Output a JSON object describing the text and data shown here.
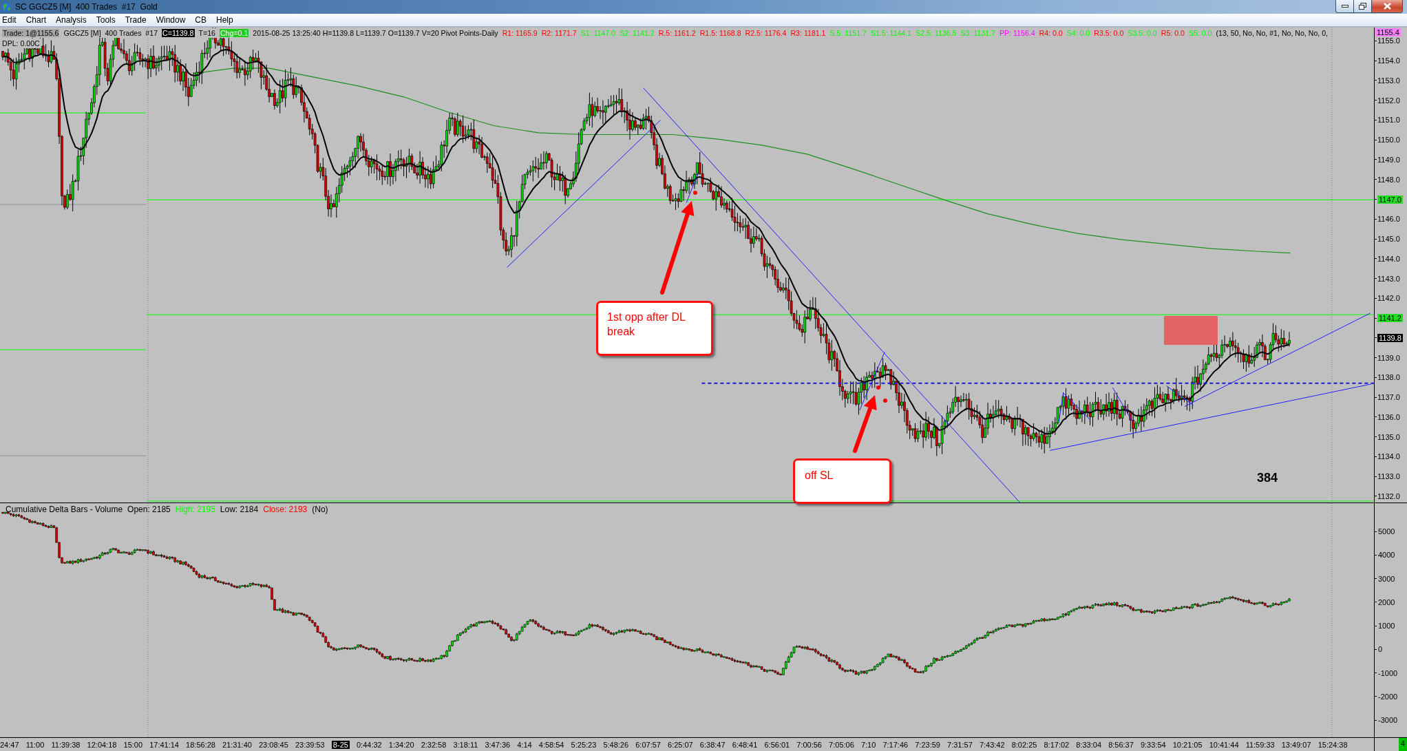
{
  "window": {
    "title": "SC GGCZ5 [M]  400 Trades  #17  Gold"
  },
  "menu": [
    "Edit",
    "Chart",
    "Analysis",
    "Tools",
    "Trade",
    "Window",
    "CB",
    "Help"
  ],
  "main_chart": {
    "info_line": [
      {
        "text": "Trade: 1@1155.6",
        "kind": "box",
        "color": "#a8a8a8"
      },
      {
        "text": "GGCZ5 [M]  400 Trades  #17",
        "kind": "text",
        "color": "#000000"
      },
      {
        "text": "C=1139.8",
        "kind": "box",
        "color": "#000000"
      },
      {
        "text": "T=16",
        "kind": "text",
        "color": "#000000"
      },
      {
        "text": "Chg=0.1",
        "kind": "box",
        "color": "#22cc22"
      },
      {
        "text": "2015-08-25 13:25:40 H=1139.8 L=1139.7 O=1139.7 V=20 Pivot Points-Daily",
        "kind": "text",
        "color": "#000000"
      },
      {
        "text": "R1: 1165.9",
        "kind": "text",
        "color": "#ff0000"
      },
      {
        "text": "R2: 1171.7",
        "kind": "text",
        "color": "#ff0000"
      },
      {
        "text": "S1: 1147.0",
        "kind": "text",
        "color": "#00ff00"
      },
      {
        "text": "S2: 1141.2",
        "kind": "text",
        "color": "#00ff00"
      },
      {
        "text": "R.5: 1161.2",
        "kind": "text",
        "color": "#ff0000"
      },
      {
        "text": "R1.5: 1168.8",
        "kind": "text",
        "color": "#ff0000"
      },
      {
        "text": "R2.5: 1176.4",
        "kind": "text",
        "color": "#ff0000"
      },
      {
        "text": "R3: 1181.1",
        "kind": "text",
        "color": "#ff0000"
      },
      {
        "text": "S.5: 1151.7",
        "kind": "text",
        "color": "#00ff00"
      },
      {
        "text": "S1.5: 1144.1",
        "kind": "text",
        "color": "#00ff00"
      },
      {
        "text": "S2.5: 1136.5",
        "kind": "text",
        "color": "#00ff00"
      },
      {
        "text": "S3: 1131.7",
        "kind": "text",
        "color": "#00ff00"
      },
      {
        "text": "PP: 1156.4",
        "kind": "text",
        "color": "#ff00ff"
      },
      {
        "text": "R4: 0.0",
        "kind": "text",
        "color": "#ff0000"
      },
      {
        "text": "S4: 0.0",
        "kind": "text",
        "color": "#00ff00"
      },
      {
        "text": "R3.5: 0.0",
        "kind": "text",
        "color": "#ff0000"
      },
      {
        "text": "S3.5: 0.0",
        "kind": "text",
        "color": "#00ff00"
      },
      {
        "text": "R5: 0.0",
        "kind": "text",
        "color": "#ff0000"
      },
      {
        "text": "S5: 0.0",
        "kind": "text",
        "color": "#00ff00"
      },
      {
        "text": "(13, 50, No, No, #1, No, No, No, 0,",
        "kind": "text",
        "color": "#000000"
      }
    ],
    "info_line_2": "DPL: 0.00C",
    "annotations": [
      {
        "kind": "callout",
        "text": "1st opp after DL break"
      },
      {
        "kind": "callout",
        "text": "off SL"
      },
      {
        "kind": "label",
        "text": "384"
      }
    ]
  },
  "price_axis": {
    "top_tag": {
      "label": "1155.4",
      "color": "#ff80ff"
    },
    "marks": [
      {
        "kind": "tick",
        "label": "1155.0"
      },
      {
        "kind": "tick",
        "label": "1154.0"
      },
      {
        "kind": "tick",
        "label": "1153.0"
      },
      {
        "kind": "tick",
        "label": "1152.0"
      },
      {
        "kind": "tick",
        "label": "1151.0"
      },
      {
        "kind": "tick",
        "label": "1150.0"
      },
      {
        "kind": "tick",
        "label": "1149.0"
      },
      {
        "kind": "tick",
        "label": "1148.0"
      },
      {
        "kind": "tag",
        "label": "1147.0",
        "color": "#22dd22"
      },
      {
        "kind": "tick",
        "label": "1146.0"
      },
      {
        "kind": "tick",
        "label": "1145.0"
      },
      {
        "kind": "tick",
        "label": "1144.0"
      },
      {
        "kind": "tick",
        "label": "1143.0"
      },
      {
        "kind": "tick",
        "label": "1142.0"
      },
      {
        "kind": "tag",
        "label": "1141.2",
        "color": "#22dd22"
      },
      {
        "kind": "tag",
        "label": "1139.8",
        "color": "#000000"
      },
      {
        "kind": "tick",
        "label": "1139.0"
      },
      {
        "kind": "tick",
        "label": "1138.0"
      },
      {
        "kind": "tick",
        "label": "1137.0"
      },
      {
        "kind": "tick",
        "label": "1136.0"
      },
      {
        "kind": "tick",
        "label": "1135.0"
      },
      {
        "kind": "tick",
        "label": "1134.0"
      },
      {
        "kind": "tick",
        "label": "1133.0"
      },
      {
        "kind": "tick",
        "label": "1132.0"
      }
    ]
  },
  "delta_panel": {
    "header": [
      {
        "text": "Cumulative Delta Bars - Volume",
        "color": "#000000"
      },
      {
        "text": "Open: 2185",
        "color": "#000000"
      },
      {
        "text": "High: 2195",
        "color": "#00ff00"
      },
      {
        "text": "Low: 2184",
        "color": "#000000"
      },
      {
        "text": "Close: 2193",
        "color": "#ff0000"
      },
      {
        "text": "(No)",
        "color": "#000000"
      }
    ]
  },
  "delta_axis": {
    "labels": [
      "5000",
      "4000",
      "3000",
      "2000",
      "1000",
      "0",
      "-1000",
      "-2000",
      "-3000"
    ]
  },
  "time_axis": {
    "labels": [
      {
        "kind": "tick",
        "label": "24:47"
      },
      {
        "kind": "tick",
        "label": "11:00"
      },
      {
        "kind": "tick",
        "label": "11:39:38"
      },
      {
        "kind": "tick",
        "label": "12:04:18"
      },
      {
        "kind": "tick",
        "label": "15:00"
      },
      {
        "kind": "tick",
        "label": "17:41:14"
      },
      {
        "kind": "tick",
        "label": "18:56:28"
      },
      {
        "kind": "tick",
        "label": "21:31:40"
      },
      {
        "kind": "tick",
        "label": "23:08:45"
      },
      {
        "kind": "tick",
        "label": "23:39:53"
      },
      {
        "kind": "tag",
        "label": "8-25",
        "color": "#000000"
      },
      {
        "kind": "tick",
        "label": "0:44:32"
      },
      {
        "kind": "tick",
        "label": "1:34:20"
      },
      {
        "kind": "tick",
        "label": "2:32:58"
      },
      {
        "kind": "tick",
        "label": "3:18:11"
      },
      {
        "kind": "tick",
        "label": "3:47:36"
      },
      {
        "kind": "tick",
        "label": "4:14"
      },
      {
        "kind": "tick",
        "label": "4:58:54"
      },
      {
        "kind": "tick",
        "label": "5:25:23"
      },
      {
        "kind": "tick",
        "label": "5:48:26"
      },
      {
        "kind": "tick",
        "label": "6:07:57"
      },
      {
        "kind": "tick",
        "label": "6:25:07"
      },
      {
        "kind": "tick",
        "label": "6:38:47"
      },
      {
        "kind": "tick",
        "label": "6:48:41"
      },
      {
        "kind": "tick",
        "label": "6:56:01"
      },
      {
        "kind": "tick",
        "label": "7:00:56"
      },
      {
        "kind": "tick",
        "label": "7:05:06"
      },
      {
        "kind": "tick",
        "label": "7:10"
      },
      {
        "kind": "tick",
        "label": "7:17:46"
      },
      {
        "kind": "tick",
        "label": "7:23:59"
      },
      {
        "kind": "tick",
        "label": "7:31:57"
      },
      {
        "kind": "tick",
        "label": "7:43:42"
      },
      {
        "kind": "tick",
        "label": "8:02:25"
      },
      {
        "kind": "tick",
        "label": "8:17:02"
      },
      {
        "kind": "tick",
        "label": "8:33:04"
      },
      {
        "kind": "tick",
        "label": "8:56:37"
      },
      {
        "kind": "tick",
        "label": "9:33:54"
      },
      {
        "kind": "tick",
        "label": "10:21:05"
      },
      {
        "kind": "tick",
        "label": "10:41:44"
      },
      {
        "kind": "tick",
        "label": "11:59:33"
      },
      {
        "kind": "tick",
        "label": "13:49:07"
      },
      {
        "kind": "tick",
        "label": "15:24:38"
      }
    ]
  },
  "corner_indicator": "4"
}
